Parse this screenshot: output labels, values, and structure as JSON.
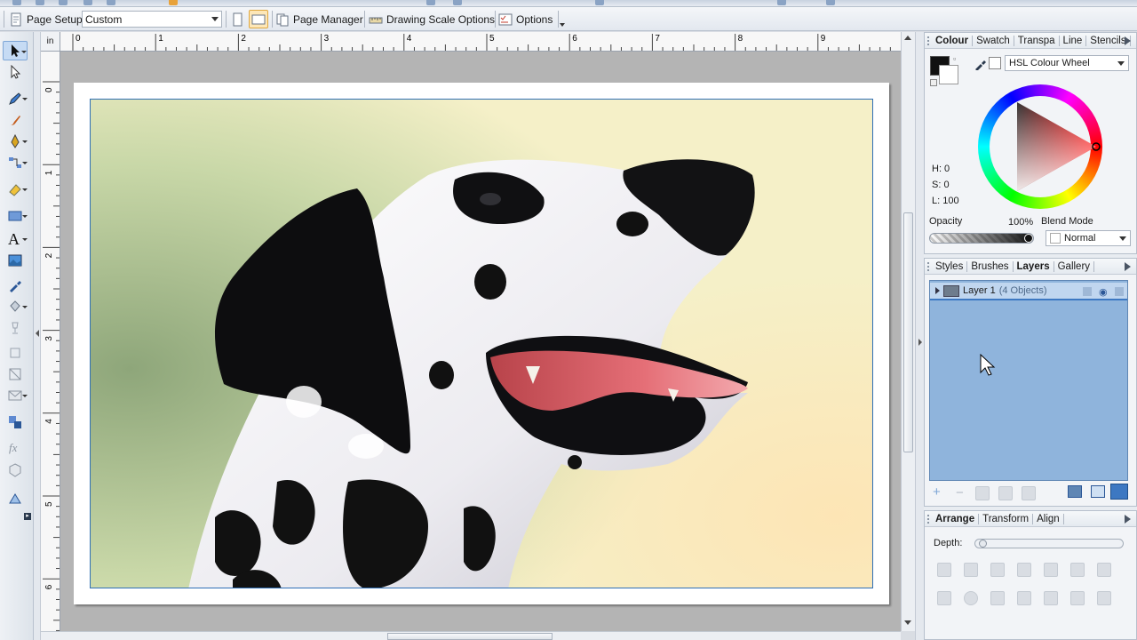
{
  "toolbar": {
    "page_setup_label": "Page Setup",
    "page_size_value": "Custom",
    "page_manager_label": "Page Manager",
    "drawing_scale_label": "Drawing Scale Options",
    "options_label": "Options"
  },
  "rulers": {
    "unit": "in",
    "h_ticks": [
      "0",
      "1",
      "2",
      "3",
      "4",
      "5",
      "6",
      "7",
      "8",
      "9"
    ],
    "v_ticks": [
      "0",
      "1",
      "2",
      "3",
      "4",
      "5",
      "6"
    ]
  },
  "colour_panel": {
    "tabs": [
      {
        "label": "Colour",
        "active": true
      },
      {
        "label": "Swatch",
        "active": false
      },
      {
        "label": "Transpa",
        "active": false
      },
      {
        "label": "Line",
        "active": false
      },
      {
        "label": "Stencils",
        "active": false
      }
    ],
    "model": "HSL Colour Wheel",
    "h_label": "H: 0",
    "s_label": "S: 0",
    "l_label": "L: 100",
    "opacity_label": "Opacity",
    "opacity_value": "100%",
    "opacity_fraction": 1.0,
    "blend_mode_label": "Blend Mode",
    "blend_mode_value": "Normal"
  },
  "layers_panel": {
    "tabs": [
      {
        "label": "Styles",
        "active": false
      },
      {
        "label": "Brushes",
        "active": false
      },
      {
        "label": "Layers",
        "active": true
      },
      {
        "label": "Gallery",
        "active": false
      }
    ],
    "layer_name": "Layer 1",
    "layer_objects": "(4 Objects)"
  },
  "arrange_panel": {
    "tabs": [
      {
        "label": "Arrange",
        "active": true
      },
      {
        "label": "Transform",
        "active": false
      },
      {
        "label": "Align",
        "active": false
      }
    ],
    "depth_label": "Depth:"
  },
  "colors": {
    "accent": "#2e6fb6",
    "layer_bg": "#8fb4dc",
    "selected_row": "#c0d6ef"
  }
}
